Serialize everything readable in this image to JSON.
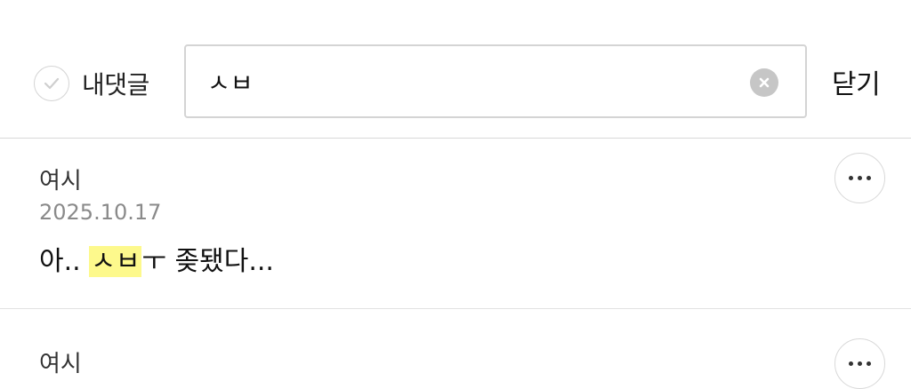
{
  "toolbar": {
    "my_comments_label": "내댓글",
    "my_comments_checked": false,
    "search_value": "ㅅㅂ",
    "close_label": "닫기"
  },
  "comments": [
    {
      "author": "여시",
      "date": "2025.10.17",
      "text_before": "아.. ",
      "text_match": "ㅅㅂ",
      "text_after": "ㅜ 좆됐다..."
    },
    {
      "author": "여시"
    }
  ],
  "icons": {
    "check": "check-icon",
    "clear": "clear-x-icon",
    "more": "more-dots-icon"
  },
  "colors": {
    "highlight": "#fdf98c",
    "divider": "#d9d9d9",
    "date": "#8a8a8a"
  }
}
